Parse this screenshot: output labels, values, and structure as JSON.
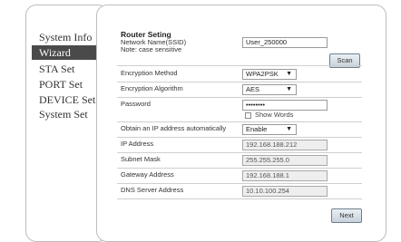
{
  "sidebar": {
    "items": [
      {
        "label": "System Info",
        "active": false
      },
      {
        "label": "Wizard",
        "active": true
      },
      {
        "label": "STA Set",
        "active": false
      },
      {
        "label": "PORT Set",
        "active": false
      },
      {
        "label": "DEVICE Set",
        "active": false
      },
      {
        "label": "System Set",
        "active": false
      }
    ]
  },
  "router": {
    "title": "Router Seting",
    "ssid_label": "Network Name(SSID)",
    "ssid_note": "Note: case sensitive",
    "ssid_value": "User_250000",
    "scan_label": "Scan",
    "encryption_method_label": "Encryption Method",
    "encryption_method_value": "WPA2PSK",
    "encryption_algorithm_label": "Encryption Algorithm",
    "encryption_algorithm_value": "AES",
    "password_label": "Password",
    "password_value": "••••••••",
    "show_words_label": "Show Words"
  },
  "network": {
    "obtain_ip_label": "Obtain an IP address automatically",
    "obtain_ip_value": "Enable",
    "ip_label": "IP Address",
    "ip_value": "192.168.188.212",
    "mask_label": "Subnet Mask",
    "mask_value": "255.255.255.0",
    "gateway_label": "Gateway Address",
    "gateway_value": "192.168.188.1",
    "dns_label": "DNS Server Address",
    "dns_value": "10.10.100.254"
  },
  "footer": {
    "next_label": "Next"
  },
  "colors": {
    "active_nav_bg": "#4a4a4a",
    "panel_border": "#bdbdbd"
  },
  "icons": {
    "select_caret": "dropdown-caret-icon"
  }
}
